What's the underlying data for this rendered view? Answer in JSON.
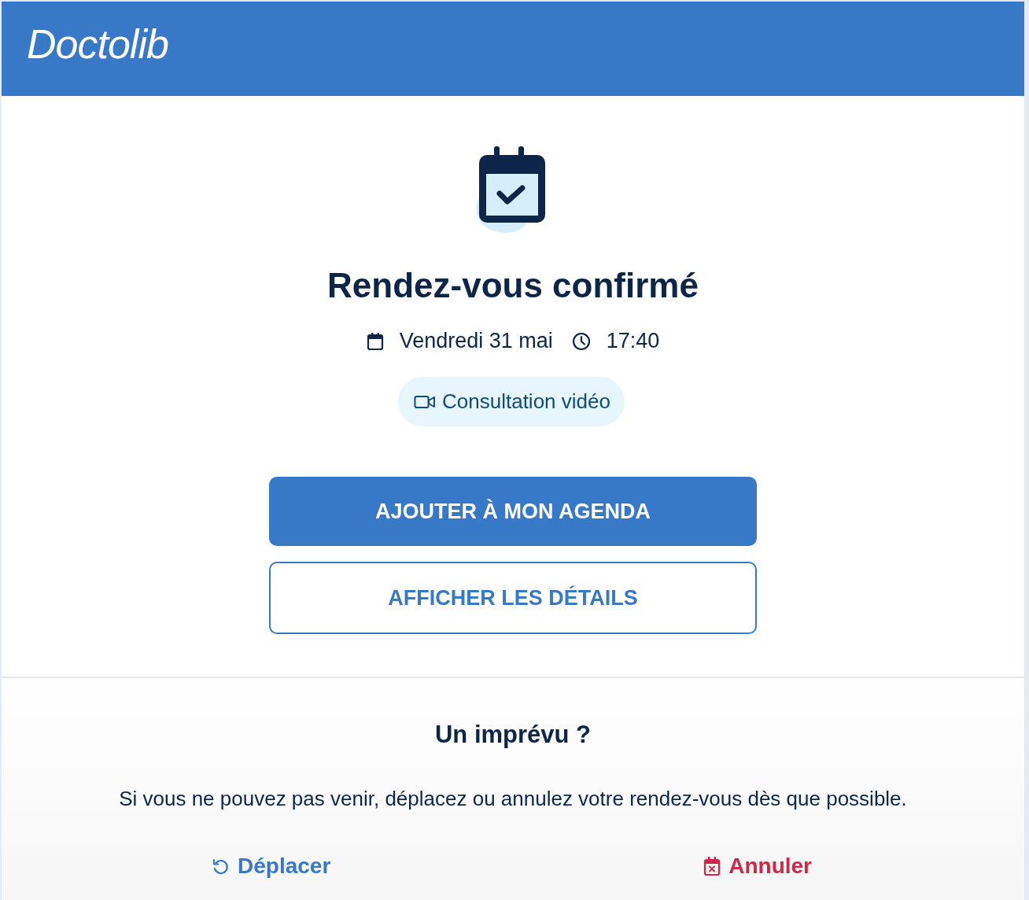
{
  "header": {
    "logo": "Doctolib"
  },
  "confirmation": {
    "title": "Rendez-vous confirmé",
    "date": "Vendredi 31 mai",
    "time": "17:40",
    "consultation_tag": "Consultation vidéo"
  },
  "buttons": [
    {
      "label": "AJOUTER À MON AGENDA",
      "kind": "primary"
    },
    {
      "label": "AFFICHER LES DÉTAILS",
      "kind": "secondary"
    }
  ],
  "unexpected": {
    "title": "Un imprévu ?",
    "text": "Si vous ne pouvez pas venir, déplacez ou annulez votre rendez-vous dès que possible."
  },
  "actions": [
    {
      "label": "Déplacer",
      "kind": "reschedule"
    },
    {
      "label": "Annuler",
      "kind": "cancel"
    }
  ]
}
